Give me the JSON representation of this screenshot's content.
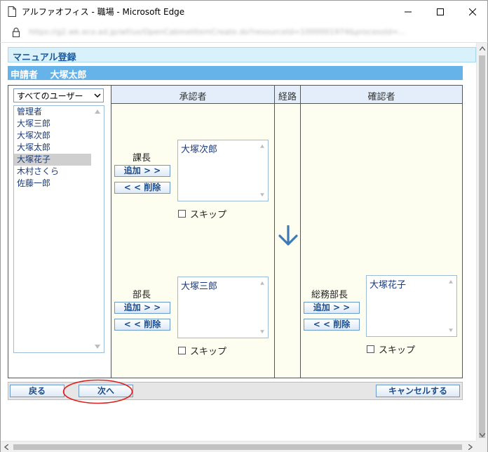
{
  "window": {
    "title": "アルファオフィス - 職場 - Microsoft Edge",
    "url": "https://g2.wk.eco.ad.jp/wf/ux/OpenCabinetItemCreate.do?resourceId=1000001974&processId=..."
  },
  "page": {
    "header": "マニュアル登録",
    "applicant": "申請者　 大塚太郎"
  },
  "columns": {
    "approver": "承認者",
    "route": "経路",
    "confirmer": "確認者"
  },
  "users": {
    "filter": "すべてのユーザー",
    "items": [
      "管理者",
      "大塚三郎",
      "大塚次郎",
      "大塚太郎",
      "大塚花子",
      "木村さくら",
      "佐藤一郎"
    ],
    "selected_index": 4
  },
  "approvers": [
    {
      "role": "課長",
      "add_label": "追加 > >",
      "remove_label": "< < 削除",
      "assigned": "大塚次郎",
      "skip_label": "スキップ",
      "skip_checked": false
    },
    {
      "role": "部長",
      "add_label": "追加 > >",
      "remove_label": "< < 削除",
      "assigned": "大塚三郎",
      "skip_label": "スキップ",
      "skip_checked": false
    }
  ],
  "confirmer": {
    "role": "総務部長",
    "add_label": "追加 > >",
    "remove_label": "< < 削除",
    "assigned": "大塚花子",
    "skip_label": "スキップ",
    "skip_checked": false
  },
  "footer": {
    "back_label": "戻る",
    "next_label": "次へ",
    "cancel_label": "キャンセルする"
  },
  "colors": {
    "header_bg": "#d9f1fb",
    "applicant_bar": "#66b3ea",
    "column_head_bg": "#e4eefb",
    "panel_bg": "#fefef0",
    "route_arrow": "#3f7ab8",
    "highlight_ring": "#e02020"
  },
  "icons": {
    "route": "arrow-down-icon",
    "filter": "chevron-down-icon"
  }
}
